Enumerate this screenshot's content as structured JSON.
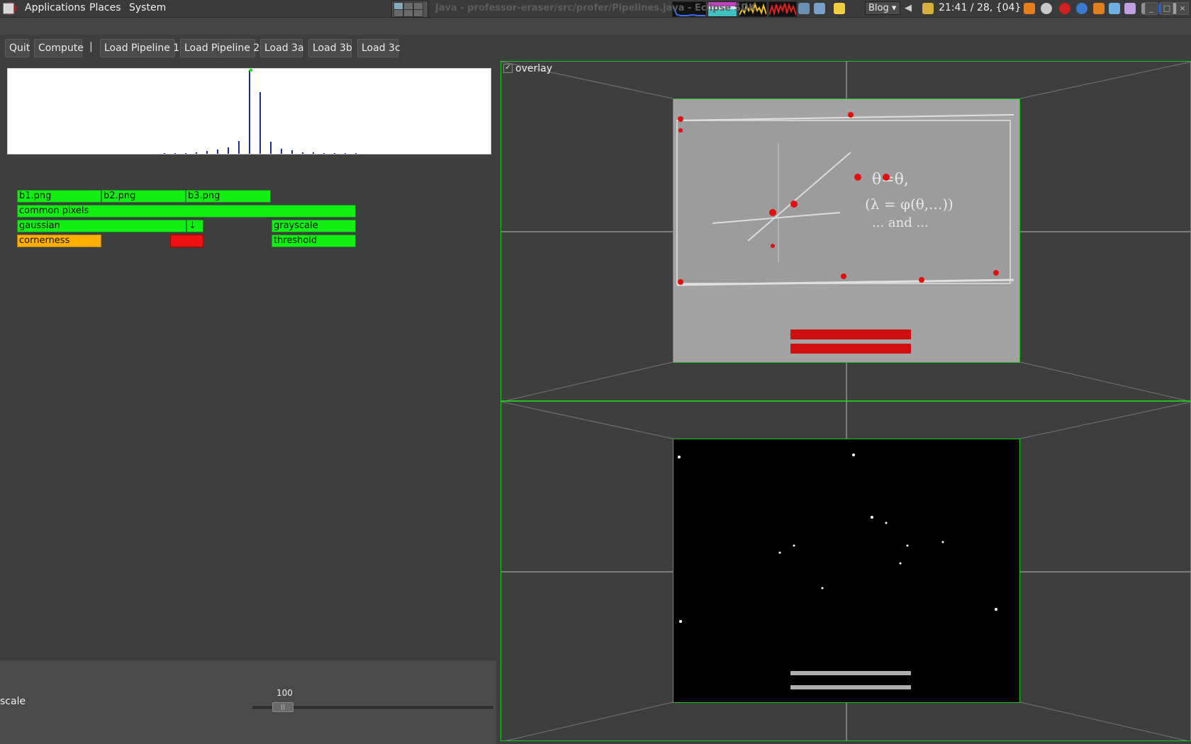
{
  "panel": {
    "menus": [
      "Applications",
      "Places",
      "System"
    ],
    "blog_combo": "Blog",
    "clock": "21:41 / 28, {04}"
  },
  "window": {
    "title": "Java - professor-eraser/src/profer/Pipelines.java - Eclipse SDK"
  },
  "toolbar": {
    "quit": "Quit",
    "compute": "Compute",
    "separator": "|",
    "load_pipeline_1": "Load Pipeline 1",
    "load_pipeline_2": "Load Pipeline 2",
    "load_3a": "Load 3a",
    "load_3b": "Load 3b",
    "load_3c": "Load 3c"
  },
  "histogram": {
    "values": [
      0.01,
      0.01,
      0.01,
      0.02,
      0.03,
      0.05,
      0.08,
      0.15,
      1.0,
      0.74,
      0.14,
      0.06,
      0.04,
      0.02,
      0.02,
      0.01,
      0.01,
      0.01,
      0.01
    ]
  },
  "pipeline": {
    "b1": "b1.png",
    "b2": "b2.png",
    "b3": "b3.png",
    "common_pixels": "common pixels",
    "gaussian": "gaussian",
    "arrow": "↓",
    "grayscale": "grayscale",
    "cornerness": "cornerness",
    "threshold": "threshold",
    "colors": {
      "done": "#11ee11",
      "active": "#ffb000",
      "error": "#ee1111"
    }
  },
  "viewer": {
    "overlay_label": "overlay",
    "overlay_checked": "✓"
  },
  "controls": {
    "scale_label": "scale",
    "slider_value": "100"
  }
}
